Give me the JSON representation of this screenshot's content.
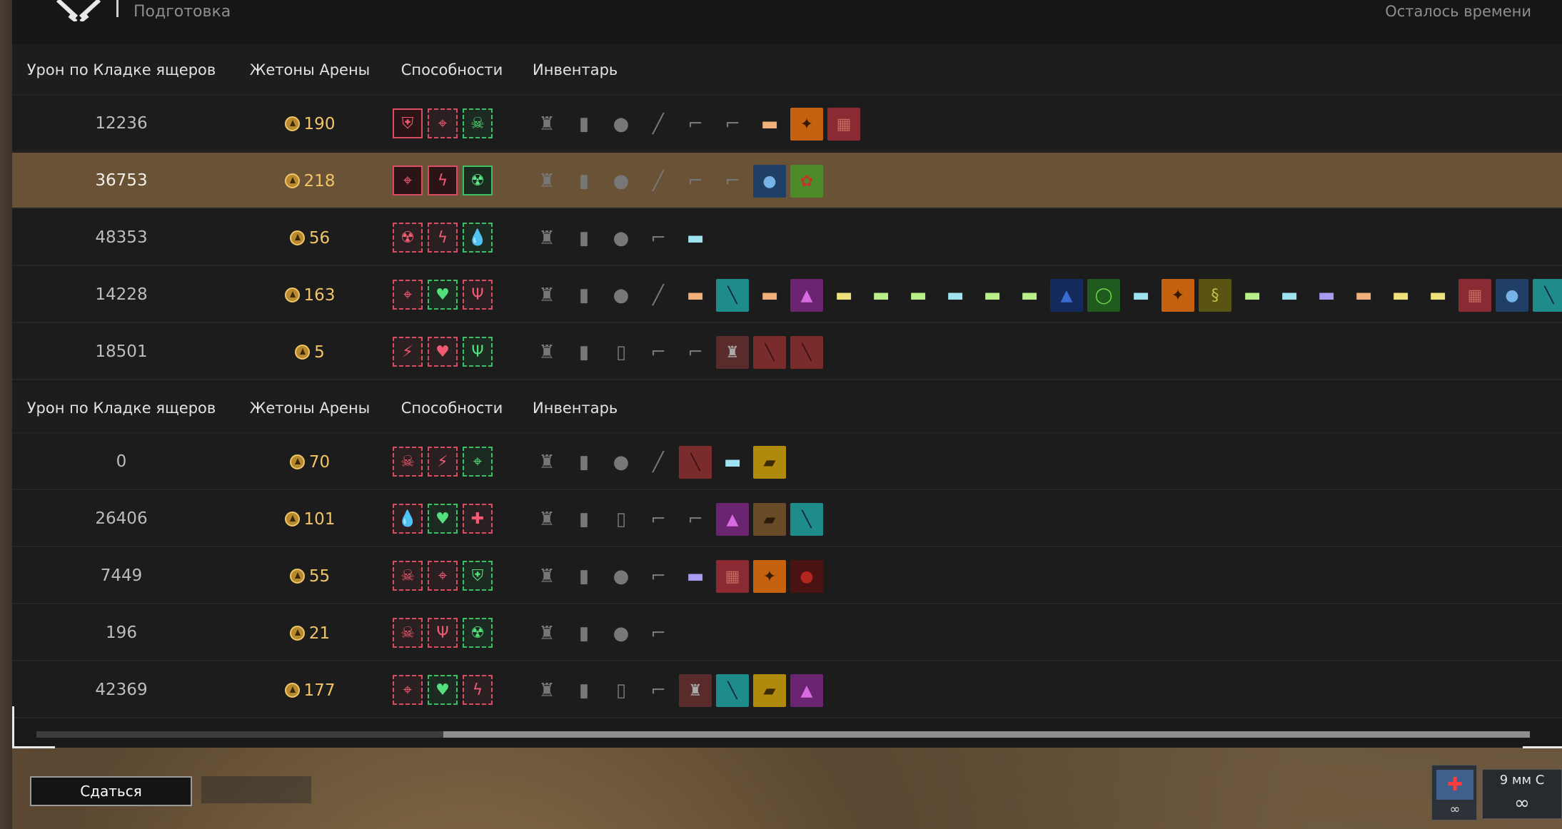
{
  "top": {
    "mode": "Подготовка",
    "time_label": "Осталось времени"
  },
  "columns": {
    "damage": "Урон по Кладке ящеров",
    "tokens": "Жетоны Арены",
    "abilities": "Способности",
    "inventory": "Инвентарь"
  },
  "team1": [
    {
      "damage": "12236",
      "tokens": "190",
      "highlight": false,
      "abilities": [
        {
          "icon": "shield-plus",
          "color": "red",
          "solid": true
        },
        {
          "icon": "crosshair",
          "color": "red"
        },
        {
          "icon": "skull-wings",
          "color": "green"
        }
      ],
      "inventory": [
        "armor",
        "vest",
        "grenade",
        "knife",
        "rifle",
        "pistol",
        "ammo-orange",
        "orange-item",
        "brick-red"
      ]
    },
    {
      "damage": "36753",
      "tokens": "218",
      "highlight": true,
      "abilities": [
        {
          "icon": "crosshair",
          "color": "red",
          "solid": true
        },
        {
          "icon": "lightning-ban",
          "color": "red",
          "solid": true
        },
        {
          "icon": "radiation",
          "color": "green",
          "solid": true
        }
      ],
      "inventory": [
        "armor",
        "vest",
        "grenade",
        "knife",
        "rifle",
        "pistol",
        "blue-bomb",
        "green-potion"
      ]
    },
    {
      "damage": "48353",
      "tokens": "56",
      "highlight": false,
      "abilities": [
        {
          "icon": "radiation",
          "color": "red"
        },
        {
          "icon": "lightning-ban",
          "color": "red"
        },
        {
          "icon": "drop-plus",
          "color": "green"
        }
      ],
      "inventory": [
        "armor",
        "vest",
        "grenade",
        "rifle",
        "ammo-blue"
      ]
    },
    {
      "damage": "14228",
      "tokens": "163",
      "highlight": false,
      "abilities": [
        {
          "icon": "crosshair",
          "color": "red"
        },
        {
          "icon": "heart-plus",
          "color": "green"
        },
        {
          "icon": "claw",
          "color": "red"
        }
      ],
      "inventory": [
        "armor",
        "vest",
        "grenade",
        "knife",
        "ammo-orange",
        "teal-item",
        "ammo-orange",
        "purple-item",
        "ammo-yellow",
        "ammo-green",
        "ammo-green",
        "ammo-blue",
        "ammo-green",
        "ammo-green",
        "blue-item",
        "green-ring",
        "ammo-blue",
        "orange-item",
        "olive-item",
        "ammo-green",
        "ammo-blue",
        "ammo-violet",
        "ammo-orange",
        "ammo-yellow",
        "ammo-yellow",
        "brick-red",
        "blue-bomb",
        "teal-item"
      ]
    },
    {
      "damage": "18501",
      "tokens": "5",
      "highlight": false,
      "abilities": [
        {
          "icon": "runner",
          "color": "red"
        },
        {
          "icon": "heart-plus",
          "color": "red"
        },
        {
          "icon": "claw",
          "color": "green"
        }
      ],
      "inventory": [
        "armor",
        "vest",
        "smg",
        "rifle",
        "pistol",
        "helmet-red",
        "red-item",
        "red-item"
      ]
    }
  ],
  "team2": [
    {
      "damage": "0",
      "tokens": "70",
      "highlight": false,
      "abilities": [
        {
          "icon": "skull",
          "color": "red"
        },
        {
          "icon": "runner",
          "color": "red"
        },
        {
          "icon": "crosshair",
          "color": "green"
        }
      ],
      "inventory": [
        "armor",
        "vest",
        "grenade",
        "knife",
        "red-item",
        "ammo-blue",
        "yellow-item"
      ]
    },
    {
      "damage": "26406",
      "tokens": "101",
      "highlight": false,
      "abilities": [
        {
          "icon": "drop-plus",
          "color": "red"
        },
        {
          "icon": "heart-plus",
          "color": "green"
        },
        {
          "icon": "medkit",
          "color": "red"
        }
      ],
      "inventory": [
        "armor",
        "vest",
        "smg",
        "rifle",
        "pistol",
        "purple-item",
        "brown-item",
        "teal-item"
      ]
    },
    {
      "damage": "7449",
      "tokens": "55",
      "highlight": false,
      "abilities": [
        {
          "icon": "skull",
          "color": "red"
        },
        {
          "icon": "crosshair",
          "color": "red"
        },
        {
          "icon": "shield-plus",
          "color": "green"
        }
      ],
      "inventory": [
        "armor",
        "vest",
        "grenade",
        "rifle",
        "ammo-violet",
        "brick-red",
        "orange-item",
        "red-orb"
      ]
    },
    {
      "damage": "196",
      "tokens": "21",
      "highlight": false,
      "abilities": [
        {
          "icon": "skull-wings",
          "color": "red"
        },
        {
          "icon": "claw",
          "color": "red"
        },
        {
          "icon": "radiation",
          "color": "green"
        }
      ],
      "inventory": [
        "armor",
        "vest",
        "grenade",
        "rifle"
      ]
    },
    {
      "damage": "42369",
      "tokens": "177",
      "highlight": false,
      "abilities": [
        {
          "icon": "crosshair",
          "color": "red"
        },
        {
          "icon": "heart-plus",
          "color": "green"
        },
        {
          "icon": "lightning-ban",
          "color": "red"
        }
      ],
      "inventory": [
        "armor",
        "vest",
        "smg",
        "rifle",
        "helmet-red",
        "teal-item",
        "yellow-item",
        "purple-item"
      ]
    }
  ],
  "footer": {
    "surrender_label": "Сдаться",
    "ammo_name": "9 мм С",
    "ammo_count": "∞",
    "slot_count": "∞"
  }
}
